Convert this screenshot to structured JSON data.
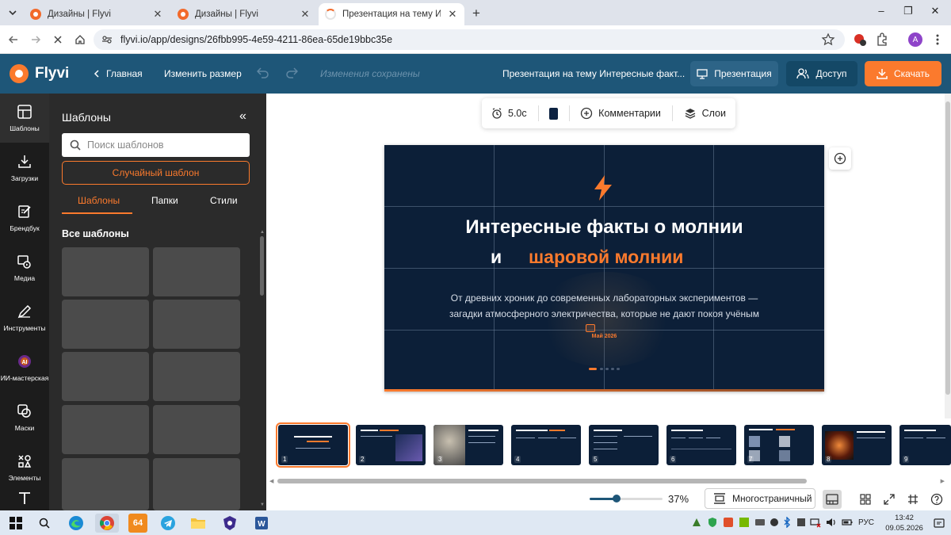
{
  "browser": {
    "tabs": [
      {
        "title": "Дизайны | Flyvi",
        "active": false
      },
      {
        "title": "Дизайны | Flyvi",
        "active": false
      },
      {
        "title": "Презентация на тему Интересн",
        "active": true
      }
    ],
    "new_tab": "+",
    "url": "flyvi.io/app/designs/26fbb995-4e59-4211-86ea-65de19bbc35e",
    "profile_initial": "A",
    "window_controls": {
      "minimize": "–",
      "restore": "❐",
      "close": "✕"
    }
  },
  "header": {
    "logo": "Flyvi",
    "home": "Главная",
    "resize": "Изменить размер",
    "saved_status": "Изменения сохранены",
    "doc_title": "Презентация на тему Интересные факт...",
    "present_label": "Презентация",
    "access_label": "Доступ",
    "download_label": "Скачать",
    "colors": {
      "bar": "#1e5678",
      "accent": "#fb7a2d",
      "access_btn": "#144866",
      "present_btn": "#2d6487"
    }
  },
  "rail": {
    "items": [
      {
        "label": "Шаблоны",
        "icon": "templates-icon",
        "active": true
      },
      {
        "label": "Загрузки",
        "icon": "upload-icon"
      },
      {
        "label": "Брендбук",
        "icon": "brandbook-icon"
      },
      {
        "label": "Медиа",
        "icon": "media-icon"
      },
      {
        "label": "Инструменты",
        "icon": "tools-icon"
      },
      {
        "label": "ИИ-мастерская",
        "icon": "ai-workshop-icon"
      },
      {
        "label": "Маски",
        "icon": "masks-icon"
      },
      {
        "label": "Элементы",
        "icon": "elements-icon"
      }
    ]
  },
  "panel": {
    "title": "Шаблоны",
    "collapse": "«",
    "search_placeholder": "Поиск шаблонов",
    "random_label": "Случайный шаблон",
    "tabs": [
      {
        "label": "Шаблоны",
        "active": true
      },
      {
        "label": "Папки"
      },
      {
        "label": "Стили"
      }
    ],
    "section_title": "Все шаблоны",
    "template_count_visible": 10
  },
  "slide_toolbar": {
    "duration": "5.0с",
    "bg_color": "#0c2241",
    "comments_label": "Комментарии",
    "layers_label": "Слои"
  },
  "slide": {
    "title_line1": "Интересные факты о молнии",
    "title_line2_white": "и",
    "title_line2_accent": "шаровой молнии",
    "subtitle_line1": "От древних хроник до современных лабораторных экспериментов —",
    "subtitle_line2": "загадки атмосферного электричества, которые не дают покоя учёным",
    "date": "Май 2026",
    "bg": "#0c1f38",
    "accent": "#fb7a2d"
  },
  "thumbnails": [
    "1",
    "2",
    "3",
    "4",
    "5",
    "6",
    "7",
    "8",
    "9"
  ],
  "selected_thumbnail": "1",
  "bottom": {
    "zoom": "37%",
    "zoom_fraction": 0.37,
    "multipage_label": "Многостраничный"
  },
  "taskbar": {
    "lang": "РУС",
    "time": "13:42",
    "date": "09.05.2026",
    "badge": "64"
  }
}
